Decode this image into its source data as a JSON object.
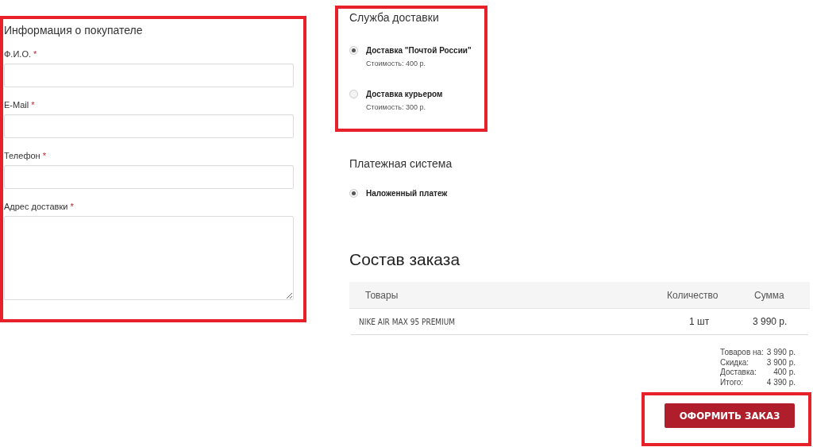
{
  "buyer": {
    "title": "Информация о покупателе",
    "fields": [
      {
        "label": "Ф.И.О.",
        "required": "*",
        "kind": "input"
      },
      {
        "label": "E-Mail",
        "required": "*",
        "kind": "input"
      },
      {
        "label": "Телефон",
        "required": "*",
        "kind": "input"
      },
      {
        "label": "Адрес доставки",
        "required": "*",
        "kind": "textarea"
      }
    ]
  },
  "delivery": {
    "title": "Служба доставки",
    "options": [
      {
        "name": "Доставка \"Почтой России\"",
        "price": "Стоимость: 400 р.",
        "selected": true
      },
      {
        "name": "Доставка курьером",
        "price": "Стоимость: 300 р.",
        "selected": false
      }
    ]
  },
  "payment": {
    "title": "Платежная система",
    "options": [
      {
        "name": "Наложенный платеж",
        "selected": true
      }
    ]
  },
  "order": {
    "title": "Состав заказа",
    "columns": [
      "Товары",
      "Количество",
      "Сумма"
    ],
    "rows": [
      {
        "product": "NIKE AIR MAX 95 PREMIUM",
        "quantity": "1 шт",
        "sum": "3 990 р."
      }
    ],
    "totals": [
      {
        "label": "Товаров на:",
        "value": "3 990 р."
      },
      {
        "label": "Скидка:",
        "value": "3 900 р."
      },
      {
        "label": "Доставка:",
        "value": "400 р."
      },
      {
        "label": "Итого:",
        "value": "4 390 р."
      }
    ],
    "submit": "ОФОРМИТЬ ЗАКАЗ"
  }
}
